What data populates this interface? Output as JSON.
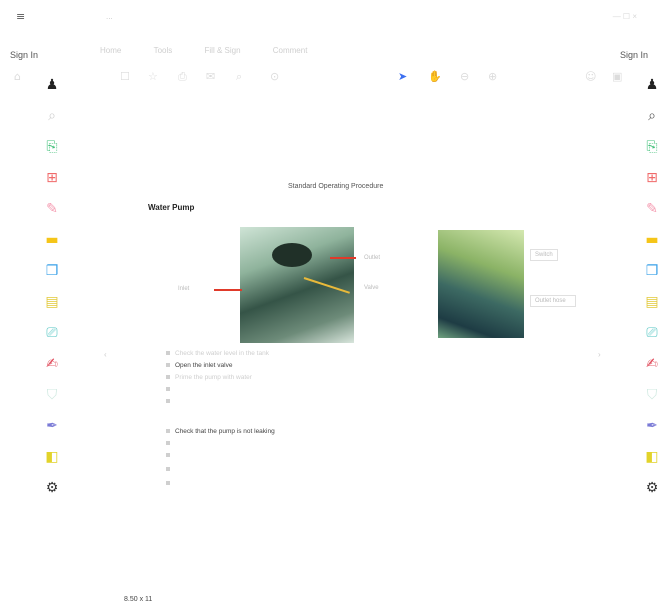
{
  "window": {
    "title": "...",
    "menu_icon": "hamburger-icon",
    "controls": "— ☐ ×"
  },
  "tabs": [
    "Home",
    "Tools",
    "Fill & Sign",
    "Comment"
  ],
  "toolbar": {
    "icons": [
      "home-icon",
      "bookmark-icon",
      "star-icon",
      "print-icon",
      "mail-icon",
      "search-icon",
      "cursor-icon",
      "hand-icon",
      "zoom-out-icon",
      "zoom-in-icon",
      "user-icon",
      "save-icon"
    ]
  },
  "sidebar_left": {
    "label": "Sign In",
    "tools": [
      {
        "icon": "add-user-icon",
        "color": "#222222"
      },
      {
        "icon": "search-icon",
        "color": "#cfcfcf"
      },
      {
        "icon": "export-pdf-icon",
        "color": "#43c07a"
      },
      {
        "icon": "create-pdf-icon",
        "color": "#f06a6a"
      },
      {
        "icon": "edit-pdf-icon",
        "color": "#f59ab0"
      },
      {
        "icon": "comment-icon",
        "color": "#f5c518"
      },
      {
        "icon": "combine-files-icon",
        "color": "#3aa1e8"
      },
      {
        "icon": "organize-pages-icon",
        "color": "#e2c93a"
      },
      {
        "icon": "scan-icon",
        "color": "#4fc3c0"
      },
      {
        "icon": "fill-sign-icon",
        "color": "#e04a5a"
      },
      {
        "icon": "protect-icon",
        "color": "#cfe9e0"
      },
      {
        "icon": "send-signature-icon",
        "color": "#7a7ad6"
      },
      {
        "icon": "stamp-icon",
        "color": "#e2d32a"
      },
      {
        "icon": "more-tools-icon",
        "color": "#333333"
      }
    ]
  },
  "sidebar_right": {
    "label": "Sign In",
    "tools": [
      {
        "icon": "add-user-icon",
        "color": "#222222"
      },
      {
        "icon": "search-icon",
        "color": "#555555"
      },
      {
        "icon": "export-pdf-icon",
        "color": "#43c07a"
      },
      {
        "icon": "create-pdf-icon",
        "color": "#f06a6a"
      },
      {
        "icon": "edit-pdf-icon",
        "color": "#f59ab0"
      },
      {
        "icon": "comment-icon",
        "color": "#f5c518"
      },
      {
        "icon": "combine-files-icon",
        "color": "#3aa1e8"
      },
      {
        "icon": "organize-pages-icon",
        "color": "#e2c93a"
      },
      {
        "icon": "scan-icon",
        "color": "#4fc3c0"
      },
      {
        "icon": "fill-sign-icon",
        "color": "#e04a5a"
      },
      {
        "icon": "protect-icon",
        "color": "#cfe9e0"
      },
      {
        "icon": "send-signature-icon",
        "color": "#7a7ad6"
      },
      {
        "icon": "stamp-icon",
        "color": "#e2d32a"
      },
      {
        "icon": "more-tools-icon",
        "color": "#333333"
      }
    ]
  },
  "document": {
    "page_heading": "Standard Operating Procedure",
    "section_title": "Water Pump",
    "photo1_labels": [
      "Outlet",
      "Inlet",
      "Valve"
    ],
    "photo2_labels": [
      "Switch",
      "Outlet hose"
    ],
    "steps": [
      "Check the water level in the tank",
      "Open the inlet valve",
      "Prime the pump with water",
      "",
      "",
      "Check that the pump is not leaking",
      "",
      "",
      "",
      ""
    ],
    "note": ""
  },
  "footer": {
    "page_size": "8.50 x 11"
  },
  "colors": {
    "accent": "#3c6ff0",
    "arrow": "#e03a2a"
  }
}
